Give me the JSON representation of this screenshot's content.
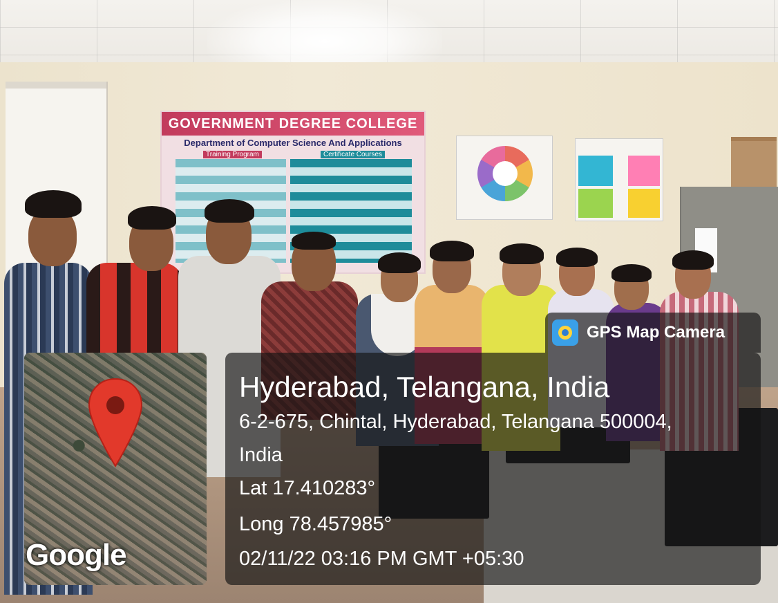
{
  "wall_banner": {
    "college": "GOVERNMENT DEGREE COLLEGE",
    "department": "Department of Computer Science And Applications",
    "left_heading": "Training Program",
    "right_heading": "Certificate Courses"
  },
  "gps_stamp": {
    "app_name": "GPS Map Camera",
    "place_title": "Hyderabad, Telangana, India",
    "address_line1": "6-2-675, Chintal, Hyderabad, Telangana 500004,",
    "address_line2": "India",
    "latitude": "Lat 17.410283°",
    "longitude": "Long 78.457985°",
    "timestamp": "02/11/22 03:16 PM GMT +05:30",
    "map_brand": "Google",
    "pin_color": "#e2392b"
  }
}
